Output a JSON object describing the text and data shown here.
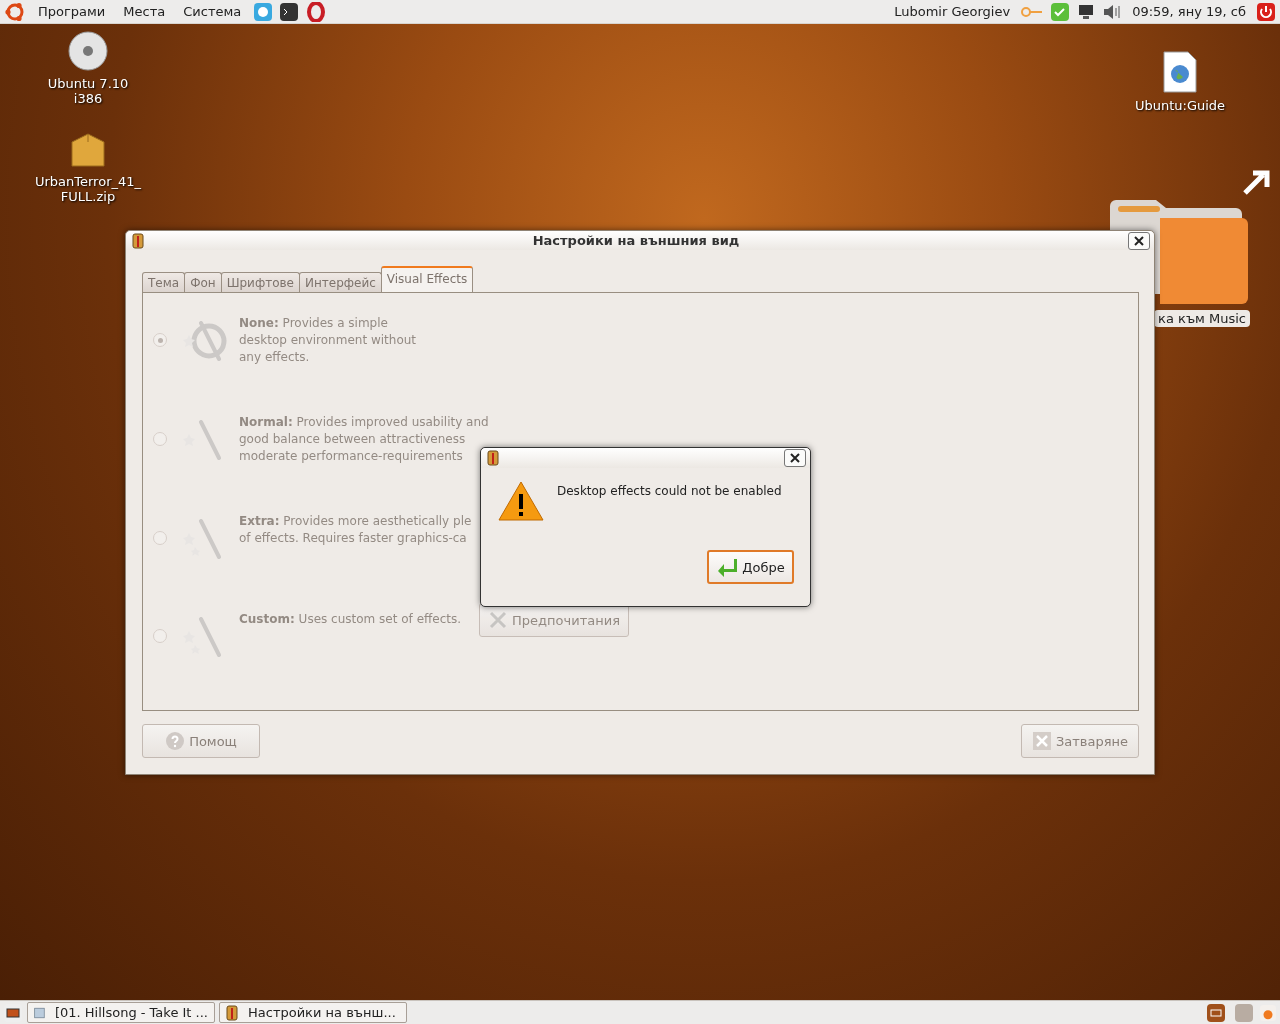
{
  "top_panel": {
    "menus": [
      "Програми",
      "Места",
      "Система"
    ],
    "user": "Lubomir Georgiev",
    "clock": "09:59, яну 19, сб"
  },
  "desktop_icons": [
    {
      "label": "Ubuntu 7.10 i386",
      "kind": "disc"
    },
    {
      "label": "UrbanTerror_41_ FULL.zip",
      "kind": "archive"
    },
    {
      "label": "Ubuntu:Guide",
      "kind": "document"
    },
    {
      "label": "ка към Music",
      "kind": "folder"
    }
  ],
  "window": {
    "title": "Настройки на външния вид",
    "disabled": true,
    "tabs": [
      {
        "label": "Тема",
        "selected": false
      },
      {
        "label": "Фон",
        "selected": false
      },
      {
        "label": "Шрифтове",
        "selected": false
      },
      {
        "label": "Интерфейс",
        "selected": false
      },
      {
        "label": "Visual Effects",
        "selected": true
      }
    ],
    "options": [
      {
        "label": "None:",
        "lines": [
          "Provides a simple",
          "desktop environment without",
          "any effects."
        ],
        "selected": true
      },
      {
        "label": "Normal:",
        "lines": [
          "Provides improved usability and",
          "good balance between attractiveness",
          "moderate performance-requirements"
        ],
        "selected": false
      },
      {
        "label": "Extra:",
        "lines": [
          "Provides more aesthetically ple",
          "of effects. Requires faster graphics-ca"
        ],
        "selected": false
      },
      {
        "label": "Custom:",
        "lines": [
          "Uses custom set of effects."
        ],
        "selected": false,
        "button": "Предпочитания"
      }
    ],
    "help_button": "Помощ",
    "close_button": "Затваряне"
  },
  "dialog": {
    "message": "Desktop effects could not be enabled",
    "button": "Добре"
  },
  "taskbar": {
    "tasks": [
      "[01. Hillsong - Take It ...",
      "Настройки на външ..."
    ]
  }
}
